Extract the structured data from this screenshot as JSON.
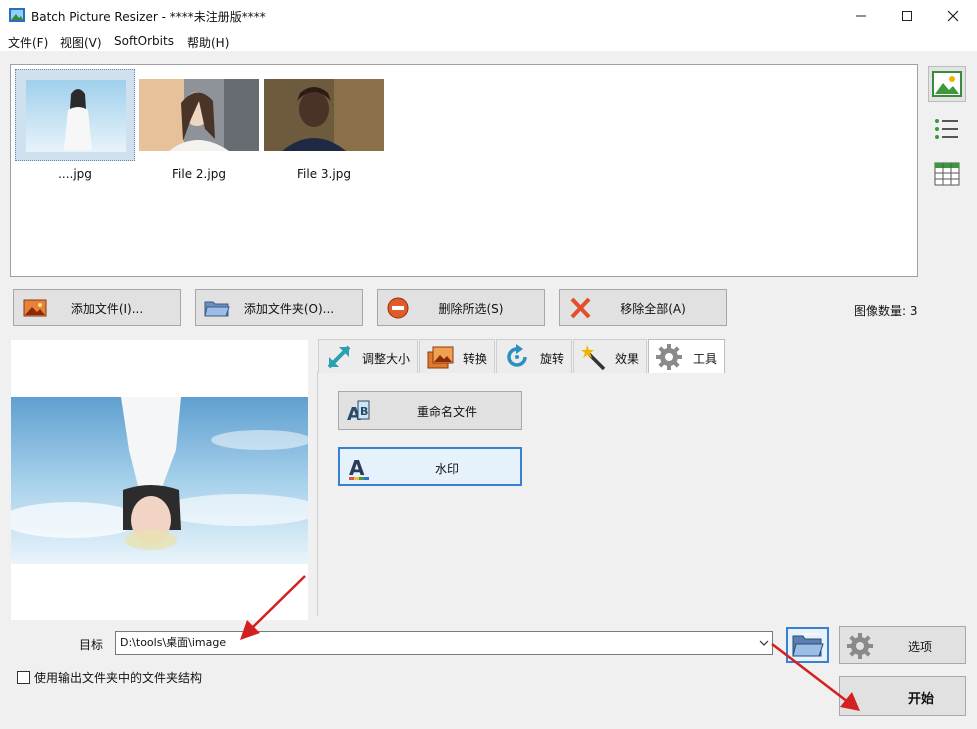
{
  "window": {
    "title": "Batch Picture Resizer - ****未注册版****",
    "minimize_icon": "minimize-icon",
    "maximize_icon": "maximize-icon",
    "close_icon": "close-icon"
  },
  "menu": {
    "items": [
      {
        "label": "文件(F)"
      },
      {
        "label": "视图(V)"
      },
      {
        "label": "SoftOrbits"
      },
      {
        "label": "帮助(H)"
      }
    ]
  },
  "thumbnails": {
    "items": [
      {
        "label": "....jpg",
        "selected": true
      },
      {
        "label": "File 2.jpg",
        "selected": false
      },
      {
        "label": "File 3.jpg",
        "selected": false
      }
    ]
  },
  "view_buttons": [
    {
      "icon": "thumbnail-view-icon",
      "active": true
    },
    {
      "icon": "list-view-icon",
      "active": false
    },
    {
      "icon": "grid-view-icon",
      "active": false
    }
  ],
  "actions": {
    "add_file": "添加文件(I)...",
    "add_folder": "添加文件夹(O)...",
    "delete_selected": "删除所选(S)",
    "remove_all": "移除全部(A)",
    "image_count": "图像数量: 3"
  },
  "tabs": [
    {
      "label": "调整大小",
      "icon": "resize-icon",
      "active": false
    },
    {
      "label": "转换",
      "icon": "convert-icon",
      "active": false
    },
    {
      "label": "旋转",
      "icon": "rotate-icon",
      "active": false
    },
    {
      "label": "效果",
      "icon": "effects-wand-icon",
      "active": false
    },
    {
      "label": "工具",
      "icon": "tools-gear-icon",
      "active": true
    }
  ],
  "tools": {
    "rename": "重命名文件",
    "watermark": "水印"
  },
  "destination": {
    "label": "目标",
    "value": "D:\\tools\\桌面\\image"
  },
  "options_button": "选项",
  "keep_structure": {
    "label": "使用输出文件夹中的文件夹结构",
    "checked": false
  },
  "start_button": "开始",
  "colors": {
    "focus_blue": "#3b7fd1",
    "annotation_red": "#d42020",
    "button_face": "#e1e1e1"
  }
}
